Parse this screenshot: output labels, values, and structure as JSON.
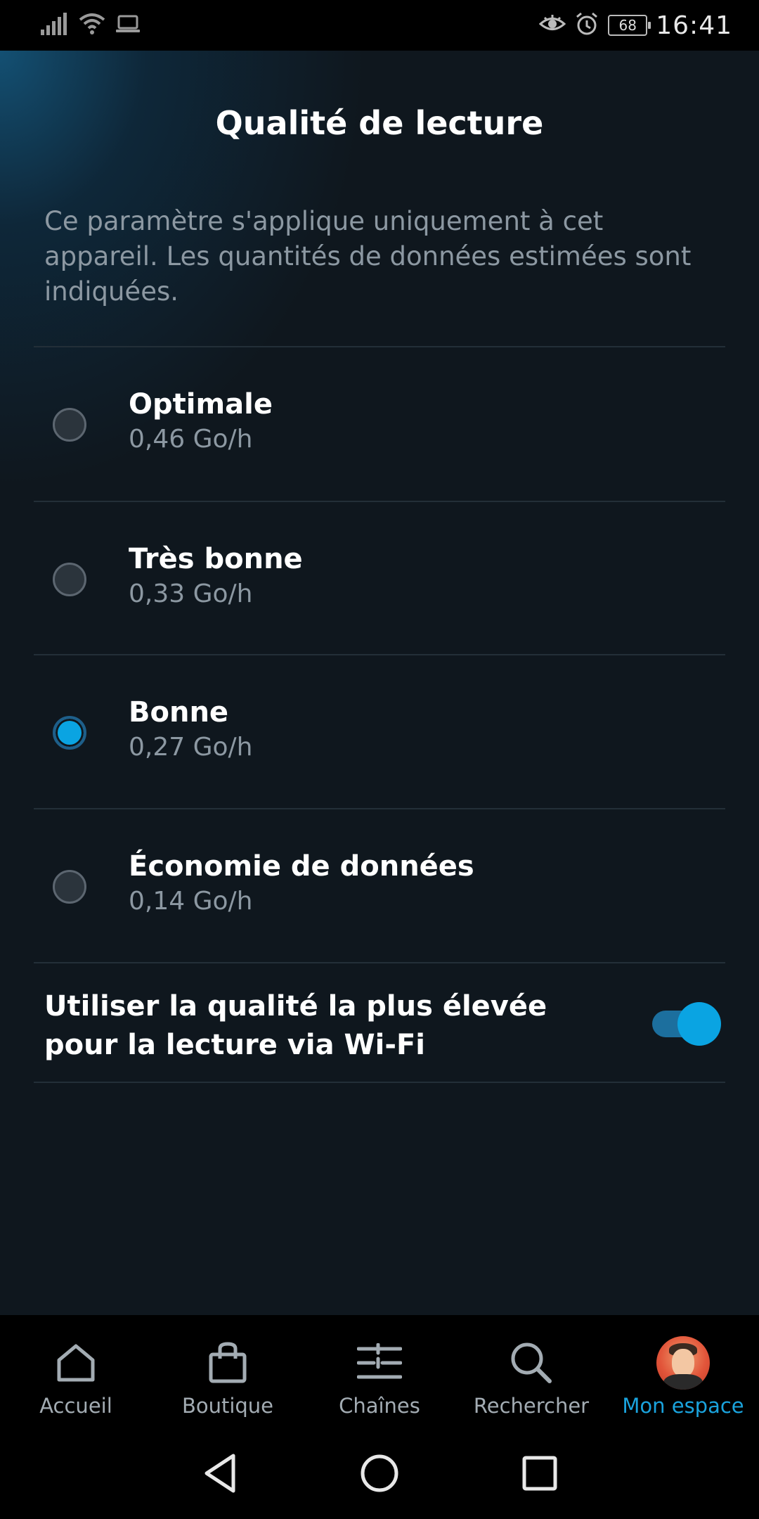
{
  "status_bar": {
    "time": "16:41",
    "battery": "68",
    "icons_left": [
      "signal-icon",
      "wifi-icon",
      "laptop-icon"
    ],
    "icons_right": [
      "eye-icon",
      "alarm-icon",
      "battery-icon"
    ]
  },
  "page": {
    "title": "Qualité de lecture",
    "description": "Ce paramètre s'applique uniquement à cet appareil. Les quantités de données estimées sont indiquées."
  },
  "options": [
    {
      "label": "Optimale",
      "value": "0,46 Go/h",
      "selected": false
    },
    {
      "label": "Très bonne",
      "value": "0,33 Go/h",
      "selected": false
    },
    {
      "label": "Bonne",
      "value": "0,27 Go/h",
      "selected": true
    },
    {
      "label": "Économie de données",
      "value": "0,14 Go/h",
      "selected": false
    }
  ],
  "wifi_setting": {
    "label": "Utiliser la qualité la plus élevée pour la lecture via Wi-Fi",
    "enabled": true
  },
  "bottom_nav": {
    "items": [
      {
        "label": "Accueil",
        "icon": "home-icon",
        "active": false
      },
      {
        "label": "Boutique",
        "icon": "shopping-bag-icon",
        "active": false
      },
      {
        "label": "Chaînes",
        "icon": "channels-icon",
        "active": false
      },
      {
        "label": "Rechercher",
        "icon": "search-icon",
        "active": false
      },
      {
        "label": "Mon espace",
        "icon": "avatar",
        "active": true
      }
    ]
  },
  "colors": {
    "accent": "#0aa4e2",
    "background": "#0f171e",
    "muted_text": "#8c98a2"
  }
}
